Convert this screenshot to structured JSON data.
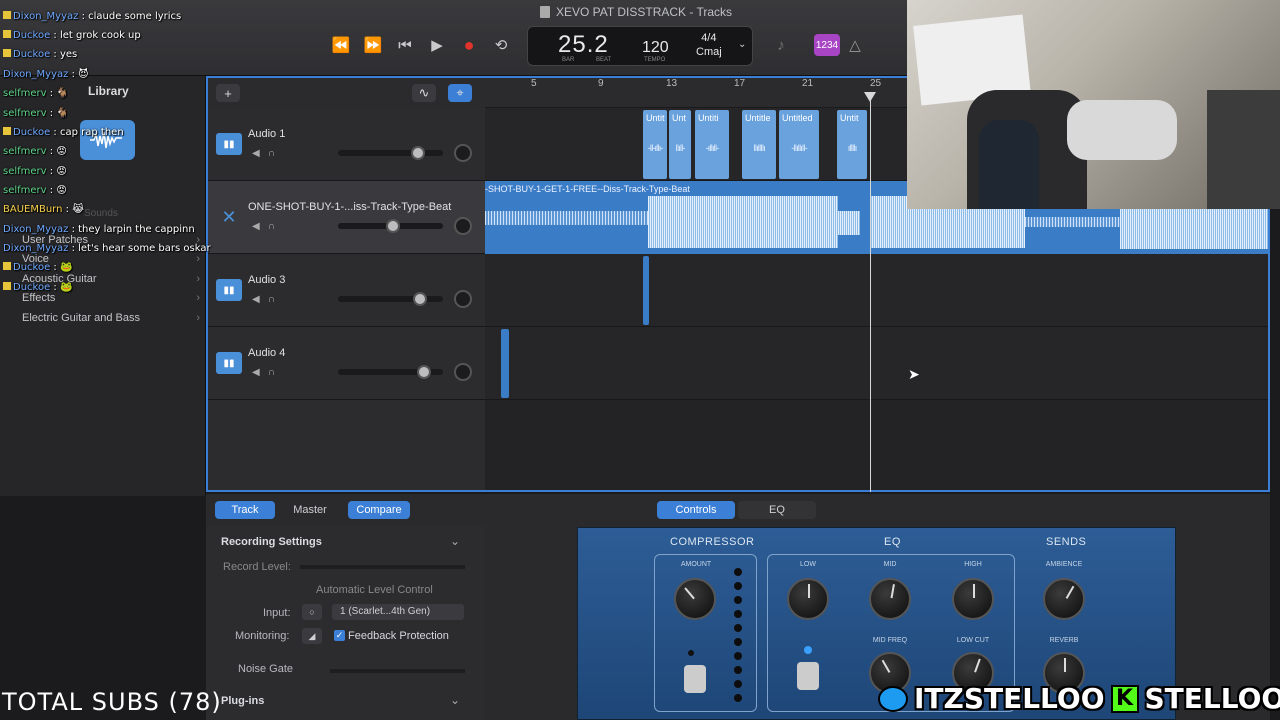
{
  "window": {
    "title": "XEVO PAT DISSTRACK - Tracks"
  },
  "lcd": {
    "position": "25.2",
    "tempo": "120",
    "time_sig": "4/4",
    "key": "Cmaj",
    "bar_label": "BAR",
    "beat_label": "BEAT",
    "tempo_label": "TEMPO"
  },
  "count_in": "1234",
  "library": {
    "title": "Library",
    "items": [
      "User Patches",
      "Voice",
      "Acoustic Guitar",
      "Effects",
      "Electric Guitar and Bass"
    ],
    "search_placeholder": "Sounds"
  },
  "ruler": {
    "bars": [
      "5",
      "9",
      "13",
      "17",
      "21",
      "25"
    ]
  },
  "tracks": [
    {
      "name": "Audio 1",
      "fader": 0.8
    },
    {
      "name": "ONE-SHOT-BUY-1-...iss-Track-Type-Beat",
      "fader": 0.53
    },
    {
      "name": "Audio 3",
      "fader": 0.82
    },
    {
      "name": "Audio 4",
      "fader": 0.87
    }
  ],
  "regions": {
    "audio1": [
      "Untit",
      "Unt",
      "Untiti",
      "Untitle",
      "Untitled",
      "Untit"
    ],
    "beat": "-SHOT-BUY-1-GET-1-FREE--Diss-Track-Type-Beat"
  },
  "editor": {
    "tabs": [
      "Track",
      "Master",
      "Compare"
    ],
    "center_tabs": [
      "Controls",
      "EQ"
    ],
    "recording_settings": "Recording Settings",
    "record_level": "Record Level:",
    "auto_level": "Automatic Level Control",
    "input_label": "Input:",
    "input_value": "1 (Scarlet...4th Gen)",
    "monitoring_label": "Monitoring:",
    "feedback": "Feedback Protection",
    "noise_gate": "Noise Gate",
    "plugins": "Plug-ins"
  },
  "plugin": {
    "compressor": "COMPRESSOR",
    "eq": "EQ",
    "sends": "SENDS",
    "amount": "AMOUNT",
    "low": "LOW",
    "mid": "MID",
    "high": "HIGH",
    "mid_freq": "MID FREQ",
    "low_cut": "LOW CUT",
    "ambience": "AMBIENCE",
    "reverb": "REVERB"
  },
  "chat": [
    {
      "user": "Dixon_Myyaz",
      "msg": "claude some lyrics"
    },
    {
      "user": "Duckoe",
      "msg": "let grok cook up"
    },
    {
      "user": "Duckoe",
      "msg": "yes"
    },
    {
      "user": "Dixon_Myyaz",
      "msg": ""
    },
    {
      "user": "selfmerv",
      "msg": ""
    },
    {
      "user": "selfmerv",
      "msg": ""
    },
    {
      "user": "Duckoe",
      "msg": "cap rap then"
    },
    {
      "user": "selfmerv",
      "msg": ""
    },
    {
      "user": "selfmerv",
      "msg": ""
    },
    {
      "user": "selfmerv",
      "msg": ""
    },
    {
      "user": "BAUEMBurn",
      "msg": ""
    },
    {
      "user": "Dixon_Myyaz",
      "msg": "they larpin the cappinn"
    },
    {
      "user": "Dixon_Myyaz",
      "msg": "let's hear some bars oskar"
    },
    {
      "user": "Duckoe",
      "msg": ""
    },
    {
      "user": "Duckoe",
      "msg": ""
    }
  ],
  "overlay": {
    "total_subs": "TOTAL SUBS (78)",
    "twitter": "ITZSTELLOO",
    "kick": "STELLOOO"
  },
  "colors": {
    "accent": "#3b7fd6",
    "region": "#6aa2de",
    "plugin": "#2d5d96",
    "kick": "#53fc18",
    "twitter": "#1d9bf0"
  }
}
